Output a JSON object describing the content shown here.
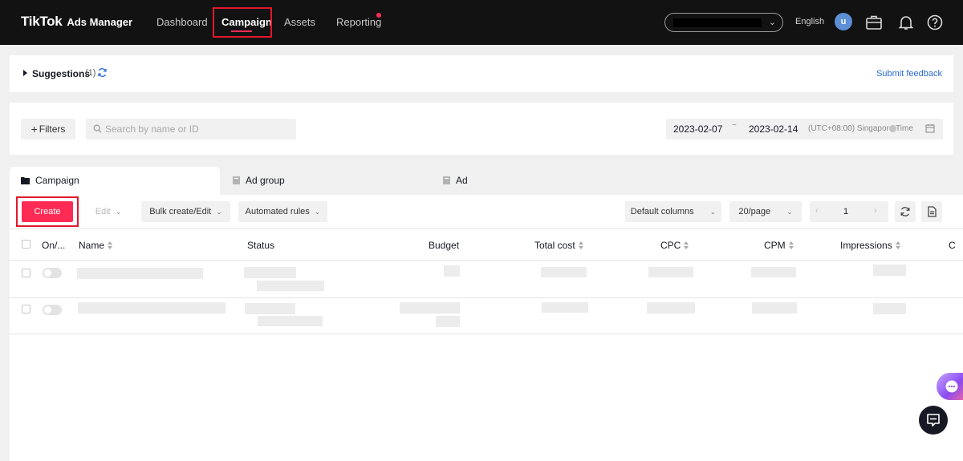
{
  "app": {
    "brand_main": "TikTok",
    "brand_sub": "Ads Manager"
  },
  "nav": {
    "items": [
      {
        "label": "Dashboard",
        "active": false
      },
      {
        "label": "Campaign",
        "active": true
      },
      {
        "label": "Assets",
        "active": false
      },
      {
        "label": "Reporting",
        "active": false,
        "badge": "red-dot"
      }
    ],
    "account_name": "",
    "language": "English",
    "avatar_letter": "u",
    "icons": [
      "briefcase-icon",
      "bell-icon",
      "help-icon"
    ]
  },
  "suggestions": {
    "label": "Suggestions",
    "count": "(1)",
    "feedback_link": "Submit feedback"
  },
  "filters": {
    "button_label": "Filters",
    "search_placeholder": "Search by name or ID",
    "date_start": "2023-02-07",
    "date_separator": "~",
    "date_end": "2023-02-14",
    "timezone": "(UTC+08:00) Singapore Time"
  },
  "tabs": [
    {
      "label": "Campaign",
      "active": true
    },
    {
      "label": "Ad group",
      "active": false
    },
    {
      "label": "Ad",
      "active": false
    }
  ],
  "toolbar": {
    "create_label": "Create",
    "edit_label": "Edit",
    "bulk_label": "Bulk create/Edit",
    "rules_label": "Automated rules",
    "columns_label": "Default columns",
    "page_size_label": "20/page",
    "page_number": "1"
  },
  "table": {
    "columns": [
      "On/...",
      "Name",
      "Status",
      "Budget",
      "Total cost",
      "CPC",
      "CPM",
      "Impressions",
      "C"
    ],
    "rows": 2
  },
  "colors": {
    "accent": "#fe2c55",
    "link": "#2a6bd1",
    "topbar": "#121212",
    "highlight": "#e0182d"
  }
}
